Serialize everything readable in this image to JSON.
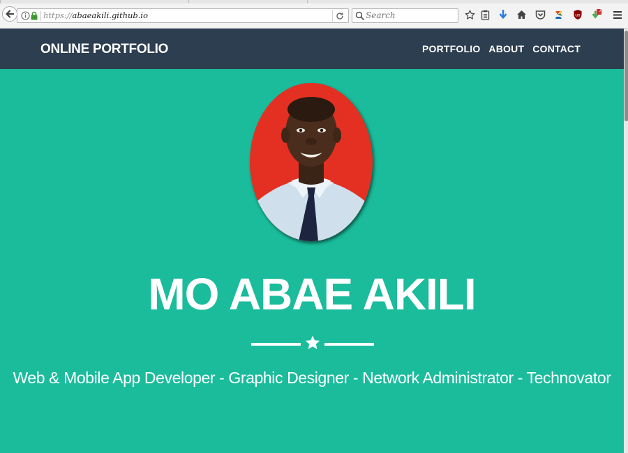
{
  "browser": {
    "url_scheme": "https://",
    "url_host": "abaeakili.github.io",
    "search_placeholder": "Search",
    "notification_count": "7"
  },
  "site": {
    "brand": "ONLINE PORTFOLIO",
    "nav": [
      {
        "label": "PORTFOLIO"
      },
      {
        "label": "ABOUT"
      },
      {
        "label": "CONTACT"
      }
    ],
    "hero": {
      "name": "MO ABAE AKILI",
      "tagline": "Web & Mobile App Developer - Graphic Designer - Network Administrator - Technovator",
      "divider_icon": "star-icon",
      "avatar_icon": "profile-photo"
    }
  },
  "colors": {
    "hero_bg": "#1abc9c",
    "navbar_bg": "#2c3e50",
    "text": "#ffffff"
  }
}
